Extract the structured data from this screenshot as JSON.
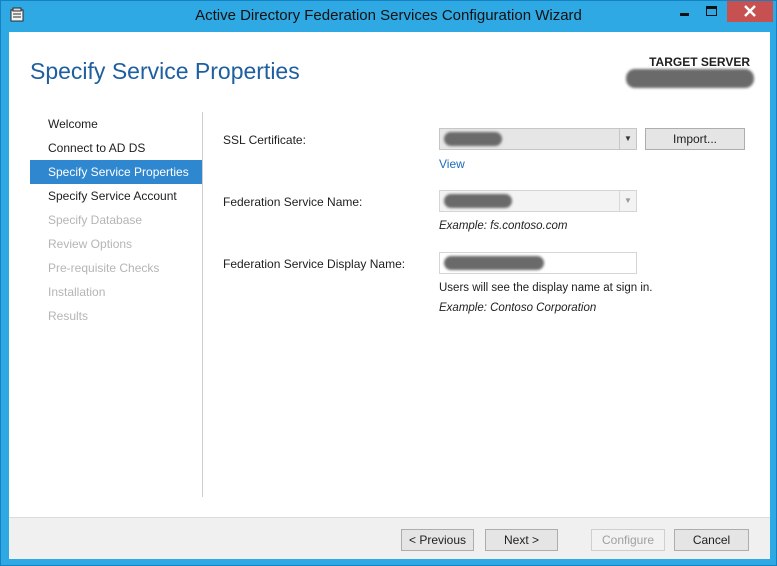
{
  "window": {
    "title": "Active Directory Federation Services Configuration Wizard"
  },
  "header": {
    "page_title": "Specify Service Properties",
    "target_server_label": "TARGET SERVER"
  },
  "nav": {
    "items": [
      {
        "label": "Welcome",
        "state": "normal"
      },
      {
        "label": "Connect to AD DS",
        "state": "normal"
      },
      {
        "label": "Specify Service Properties",
        "state": "active"
      },
      {
        "label": "Specify Service Account",
        "state": "normal"
      },
      {
        "label": "Specify Database",
        "state": "disabled"
      },
      {
        "label": "Review Options",
        "state": "disabled"
      },
      {
        "label": "Pre-requisite Checks",
        "state": "disabled"
      },
      {
        "label": "Installation",
        "state": "disabled"
      },
      {
        "label": "Results",
        "state": "disabled"
      }
    ]
  },
  "form": {
    "ssl_certificate_label": "SSL Certificate:",
    "import_button": "Import...",
    "view_link": "View",
    "federation_service_name_label": "Federation Service Name:",
    "federation_service_name_example": "Example: fs.contoso.com",
    "display_name_label": "Federation Service Display Name:",
    "display_name_note": "Users will see the display name at sign in.",
    "display_name_example": "Example: Contoso Corporation"
  },
  "footer": {
    "previous": "< Previous",
    "next": "Next >",
    "configure": "Configure",
    "cancel": "Cancel"
  },
  "colors": {
    "titlebar": "#2fa9e4",
    "accent": "#2f87d0",
    "heading": "#1e5fa0",
    "close_button": "#c75050"
  },
  "icons": {
    "app": "wizard-app-icon",
    "minimize": "minimize-icon",
    "maximize": "maximize-icon",
    "close": "close-icon",
    "dropdown": "chevron-down-icon"
  }
}
